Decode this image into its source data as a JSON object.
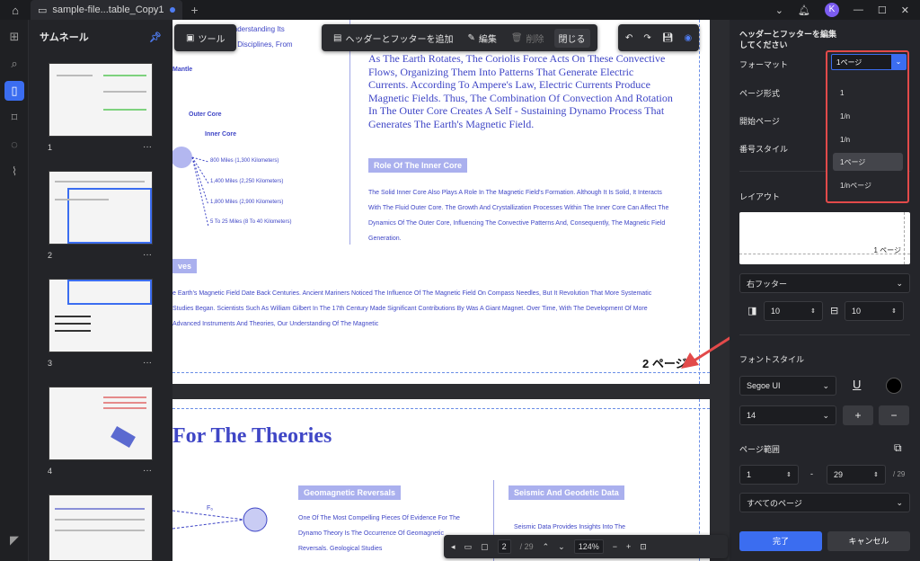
{
  "titlebar": {
    "tab_title": "sample-file...table_Copy1",
    "avatar_letter": "K"
  },
  "thumbnails": {
    "title": "サムネール",
    "pages": [
      {
        "num": "1"
      },
      {
        "num": "2"
      },
      {
        "num": "3"
      },
      {
        "num": "4"
      }
    ]
  },
  "toolbar": {
    "tool_label": "ツール",
    "add_header_footer_label": "ヘッダーとフッターを追加",
    "edit_label": "編集",
    "delete_label": "削除",
    "close_label": "閉じる"
  },
  "document": {
    "pg1_header_a": "Understanding Its",
    "pg1_header_b": "fic Disciplines, From",
    "pg1_para1": "As The Earth Rotates, The Coriolis Force Acts On These Convective Flows, Organizing Them Into Patterns That Generate Electric Currents. According To Ampere's Law, Electric Currents Produce Magnetic Fields. Thus, The Combination Of Convection And Rotation In The Outer Core Creates A Self - Sustaining Dynamo Process That Generates The Earth's Magnetic Field.",
    "diagram_mantle": "Mantle",
    "diagram_outer_core": "Outer Core",
    "diagram_inner_core": "Inner Core",
    "diagram_d1": "800 Miles (1,300 Kilometers)",
    "diagram_d2": "1,400 Miles (2,250 Kilometers)",
    "diagram_d3": "1,800 Miles (2,900 Kilometers)",
    "diagram_d4": "5 To 25 Miles (8 To 40 Kilometers)",
    "inner_core_heading": "Role Of The Inner Core",
    "inner_core_text": "The Solid Inner Core Also Plays A Role In The Magnetic Field's Formation. Although It Is Solid, It Interacts With The Fluid Outer Core. The Growth And Crystallization Processes Within The Inner Core Can Affect The Dynamics Of The Outer Core, Influencing The Convective Patterns And, Consequently, The Magnetic Field Generation.",
    "ves_heading": "ves",
    "history_text": "e Earth's Magnetic Field Date Back Centuries. Ancient Mariners Noticed The Influence Of The Magnetic Field On Compass Needles, But It Revolution That More Systematic Studies Began. Scientists Such As William Gilbert In The 17th Century Made Significant Contributions By Was A Giant Magnet. Over Time, With The Development Of More Advanced Instruments And Theories, Our Understanding Of The Magnetic",
    "footer_page_label": "2 ページ",
    "pg2_title": "For The Theories",
    "geo_heading": "Geomagnetic Reversals",
    "geo_text": "One Of The Most Compelling Pieces Of Evidence For The Dynamo Theory Is The Occurrence Of Geomagnetic Reversals. Geological Studies",
    "seis_heading": "Seismic And Geodetic Data",
    "seis_text": "Seismic Data Provides Insights Into The",
    "diagram_fx": "F₆"
  },
  "panel": {
    "title": "ヘッダーとフッターを編集してください",
    "format_label": "フォーマット",
    "format_value": "1ページ",
    "format_options": [
      "1",
      "1/n",
      "1/n",
      "1ページ",
      "1/nページ"
    ],
    "page_format_label": "ページ形式",
    "start_page_label": "開始ページ",
    "number_style_label": "番号スタイル",
    "layout_label": "レイアウト",
    "layout_preview_text": "1 ページ",
    "position_value": "右フッター",
    "margin_left_value": "10",
    "margin_bottom_value": "10",
    "font_style_label": "フォントスタイル",
    "font_value": "Segoe UI",
    "size_value": "14",
    "page_range_label": "ページ範囲",
    "range_from": "1",
    "range_to": "29",
    "range_total": "/ 29",
    "range_dash": "-",
    "pages_subset": "すべてのページ",
    "ok_label": "完了",
    "cancel_label": "キャンセル",
    "font_color": "#000000",
    "accent": "#3b6df0",
    "highlight_border": "#e24a4a"
  },
  "bottombar": {
    "current_page": "2",
    "total_pages": "/ 29",
    "zoom": "124%"
  }
}
